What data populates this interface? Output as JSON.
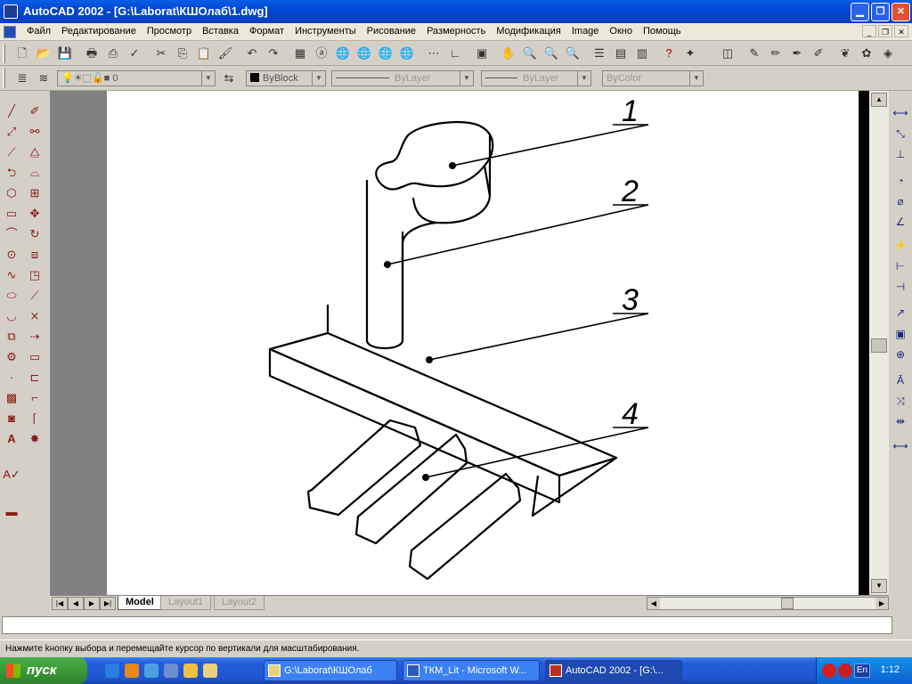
{
  "window": {
    "title": "AutoCAD 2002 - [G:\\Laborat\\КШОлаб\\1.dwg]"
  },
  "menu": {
    "items": [
      "Файл",
      "Редактирование",
      "Просмотр",
      "Вставка",
      "Формат",
      "Инструменты",
      "Рисование",
      "Размерность",
      "Модификация",
      "Image",
      "Окно",
      "Помощь"
    ]
  },
  "layers": {
    "current_layer": "0",
    "color": "ByBlock",
    "linetype": "ByLayer",
    "lineweight": "ByLayer",
    "plotstyle": "ByColor"
  },
  "drawing": {
    "callouts": [
      "1",
      "2",
      "3",
      "4"
    ]
  },
  "layout_tabs": [
    "Model",
    "Layout1",
    "Layout2"
  ],
  "command": {
    "value": "",
    "status_text": "Нажмите kнопку выбора и перемещайте курсор по вертикали для масштабирования."
  },
  "taskbar": {
    "start_label": "пуск",
    "tasks": [
      "G:\\Laborat\\КШОлаб",
      "ТКМ_Lit - Microsoft W...",
      "AutoCAD 2002 - [G:\\..."
    ],
    "language": "En",
    "clock": "1:12"
  },
  "colors": {
    "titlebar": "#0a5ee6",
    "taskbar": "#245edb",
    "start": "#3a9a38",
    "canvas": "#ffffff"
  }
}
